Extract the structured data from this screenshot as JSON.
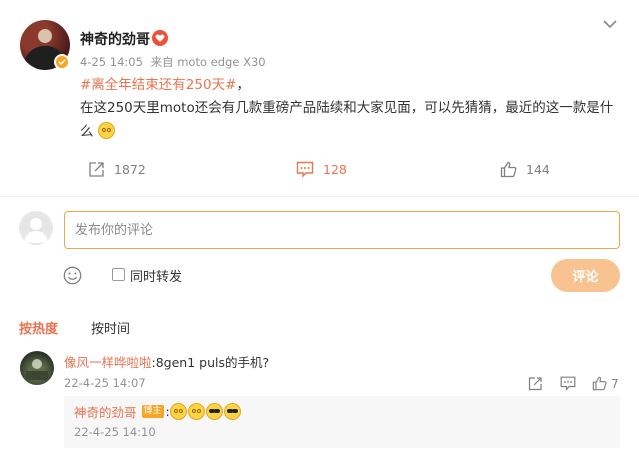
{
  "post": {
    "author": "神奇的劲哥",
    "date": "4-25 14:05",
    "source_prefix": "来自",
    "device": "moto edge X30",
    "topic": "#离全年结束还有250天#",
    "topic_suffix": "，",
    "body": "在这250天里moto还会有几款重磅产品陆续和大家见面，可以先猜猜，最近的这一款是什么",
    "forwards": "1872",
    "comments": "128",
    "likes": "144"
  },
  "composer": {
    "placeholder": "发布你的评论",
    "repost_label": "同时转发",
    "submit_label": "评论"
  },
  "sort": {
    "hot": "按热度",
    "time": "按时间"
  },
  "comment": {
    "user": "像风一样哗啦啦",
    "text": ":8gen1 puls的手机?",
    "time": "22-4-25 14:07",
    "likes": "7",
    "reply": {
      "user": "神奇的劲哥",
      "badge": "博主",
      "colon": ":",
      "time": "22-4-25 14:10",
      "emojis": [
        "awkward-emoji",
        "awkward-emoji",
        "cool-emoji",
        "cool-emoji"
      ]
    }
  },
  "colors": {
    "accent": "#eb7350",
    "input_border": "#f0a550",
    "submit_bg": "#f9c391",
    "verified": "#f5a623"
  }
}
